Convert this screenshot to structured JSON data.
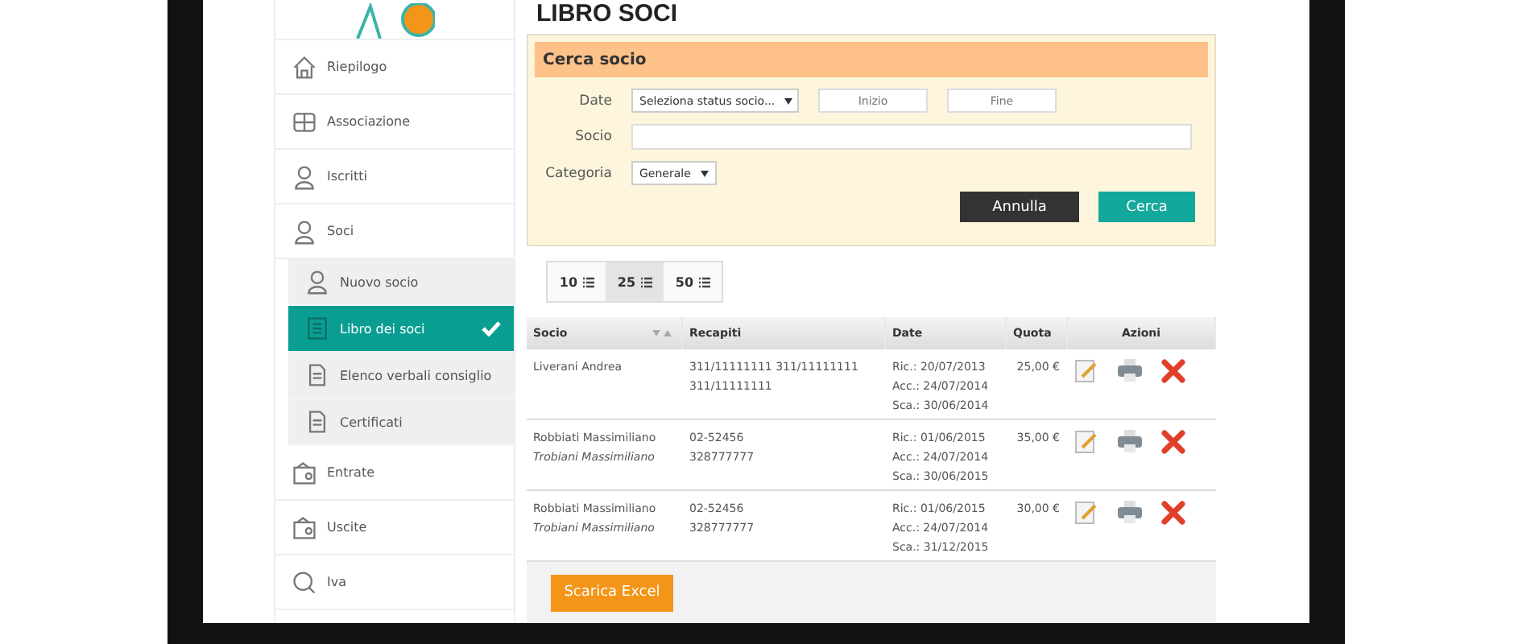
{
  "page_title": "LIBRO SOCI",
  "sidebar": {
    "items": [
      {
        "label": "Riepilogo",
        "kind": "main",
        "selected": false
      },
      {
        "label": "Associazione",
        "kind": "main",
        "selected": false
      },
      {
        "label": "Iscritti",
        "kind": "main",
        "selected": false
      },
      {
        "label": "Soci",
        "kind": "main",
        "selected": false
      },
      {
        "label": "Nuovo socio",
        "kind": "sub",
        "selected": false
      },
      {
        "label": "Libro dei soci",
        "kind": "sub",
        "selected": true
      },
      {
        "label": "Elenco verbali consiglio",
        "kind": "sub",
        "selected": false
      },
      {
        "label": "Certificati",
        "kind": "sub",
        "selected": false
      },
      {
        "label": "Entrate",
        "kind": "main",
        "selected": false
      },
      {
        "label": "Uscite",
        "kind": "main",
        "selected": false
      },
      {
        "label": "Iva",
        "kind": "main",
        "selected": false
      }
    ]
  },
  "search": {
    "title": "Cerca socio",
    "date_label": "Date",
    "status_select": "Seleziona status socio...",
    "start": {
      "placeholder": "Inizio"
    },
    "end": {
      "placeholder": "Fine"
    },
    "socio_label": "Socio",
    "categoria_label": "Categoria",
    "categoria_select": "Generale",
    "buttons": [
      {
        "label": "Annulla",
        "kind": "secondary"
      },
      {
        "label": "Cerca",
        "kind": "primary"
      }
    ]
  },
  "page_sizes": [
    {
      "label": "10",
      "selected": false
    },
    {
      "label": "25",
      "selected": true
    },
    {
      "label": "50",
      "selected": false
    }
  ],
  "table": {
    "columns": [
      "Socio",
      "Recapiti",
      "Date",
      "Quota",
      "Azioni"
    ],
    "rows": [
      {
        "socio": "Liverani Andrea",
        "recapiti": [
          "311/11111111 311/11111111",
          "311/11111111"
        ],
        "date": [
          "Ric.: 20/07/2013",
          "Acc.: 24/07/2014",
          "Sca.: 30/06/2014"
        ],
        "quota": "25,00 €"
      },
      {
        "socio": "Robbiati Massimiliano",
        "alias": "Trobiani Massimiliano",
        "recapiti": [
          "02-52456",
          "328777777"
        ],
        "date": [
          "Ric.: 01/06/2015",
          "Acc.: 24/07/2014",
          "Sca.: 30/06/2015"
        ],
        "quota": "35,00 €"
      },
      {
        "socio": "Robbiati Massimiliano",
        "alias": "Trobiani Massimiliano",
        "recapiti": [
          "02-52456",
          "328777777"
        ],
        "date": [
          "Ric.: 01/06/2015",
          "Acc.: 24/07/2014",
          "Sca.: 31/12/2015"
        ],
        "quota": "30,00 €"
      }
    ]
  },
  "export_button": "Scarica Excel"
}
